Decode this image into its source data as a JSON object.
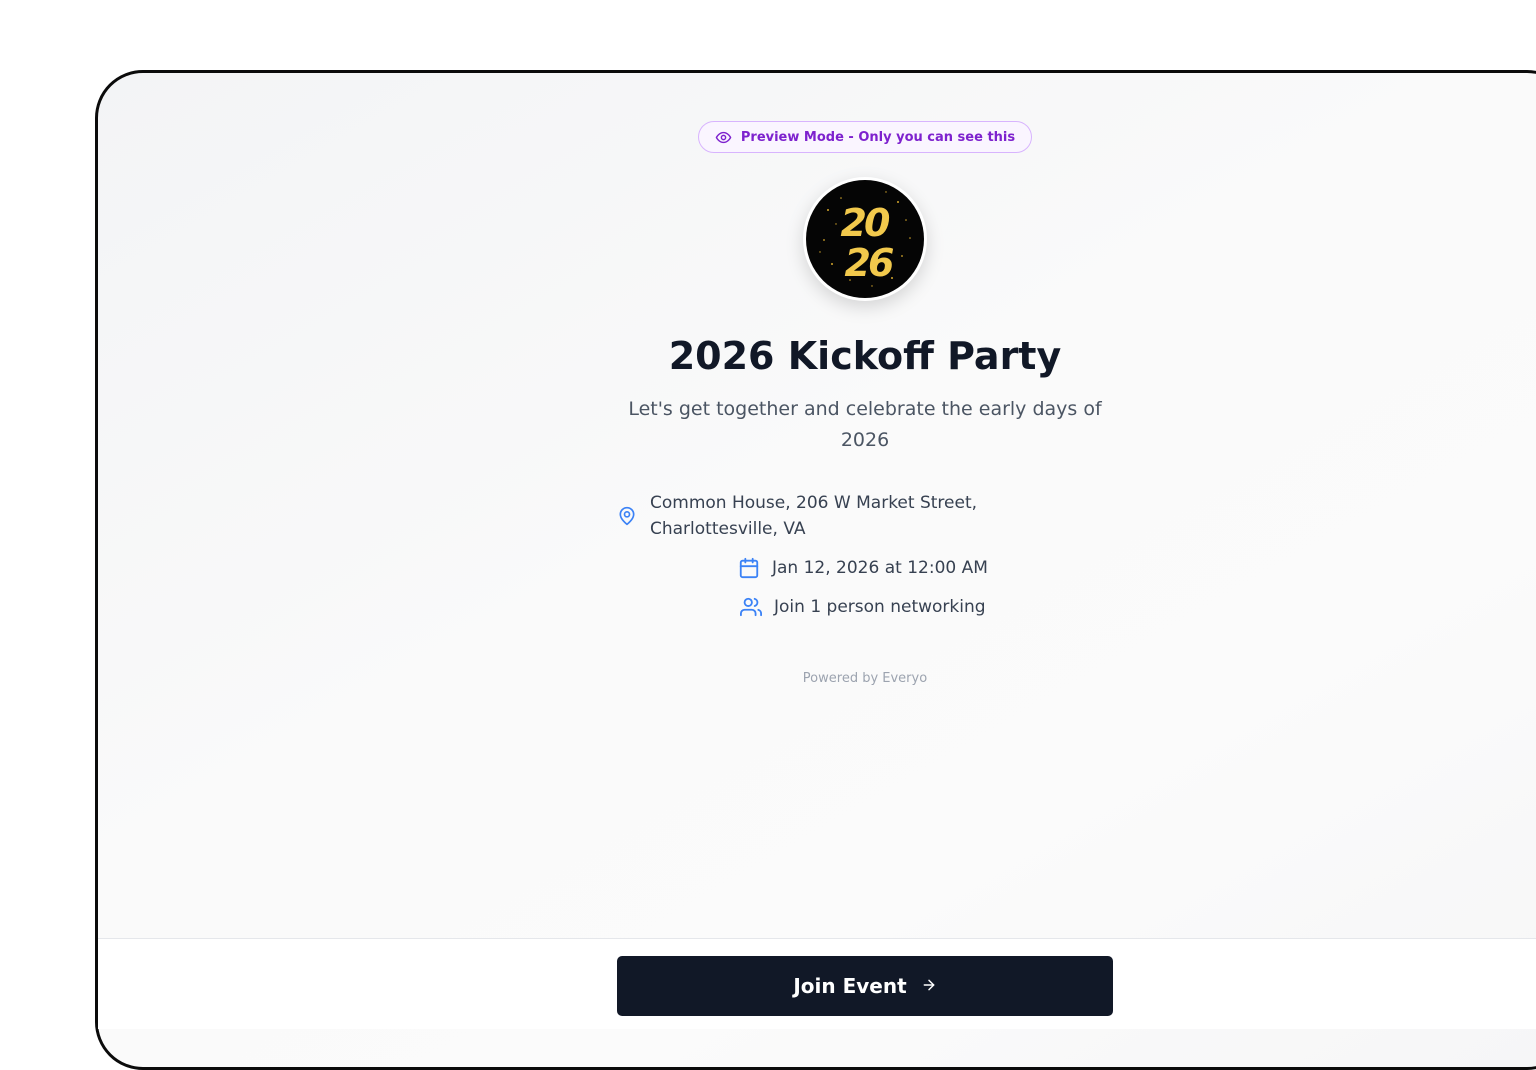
{
  "preview": {
    "label": "Preview Mode - Only you can see this",
    "icon": "eye-icon",
    "color": "#7e22ce"
  },
  "event": {
    "logo_text_top": "20",
    "logo_text_bottom": "26",
    "title": "2026 Kickoff Party",
    "description": "Let's get together and celebrate the early days of 2026",
    "location": "Common House, 206 W Market Street, Charlottesville, VA",
    "datetime": "Jan 12, 2026 at 12:00 AM",
    "attendees": "Join 1 person networking"
  },
  "icons": {
    "location": "map-pin-icon",
    "date": "calendar-icon",
    "people": "users-icon",
    "accent": "#3b82f6"
  },
  "footer": {
    "powered_by": "Powered by Everyo"
  },
  "action": {
    "join_label": "Join Event",
    "arrow": "→",
    "button_color": "#111827"
  }
}
